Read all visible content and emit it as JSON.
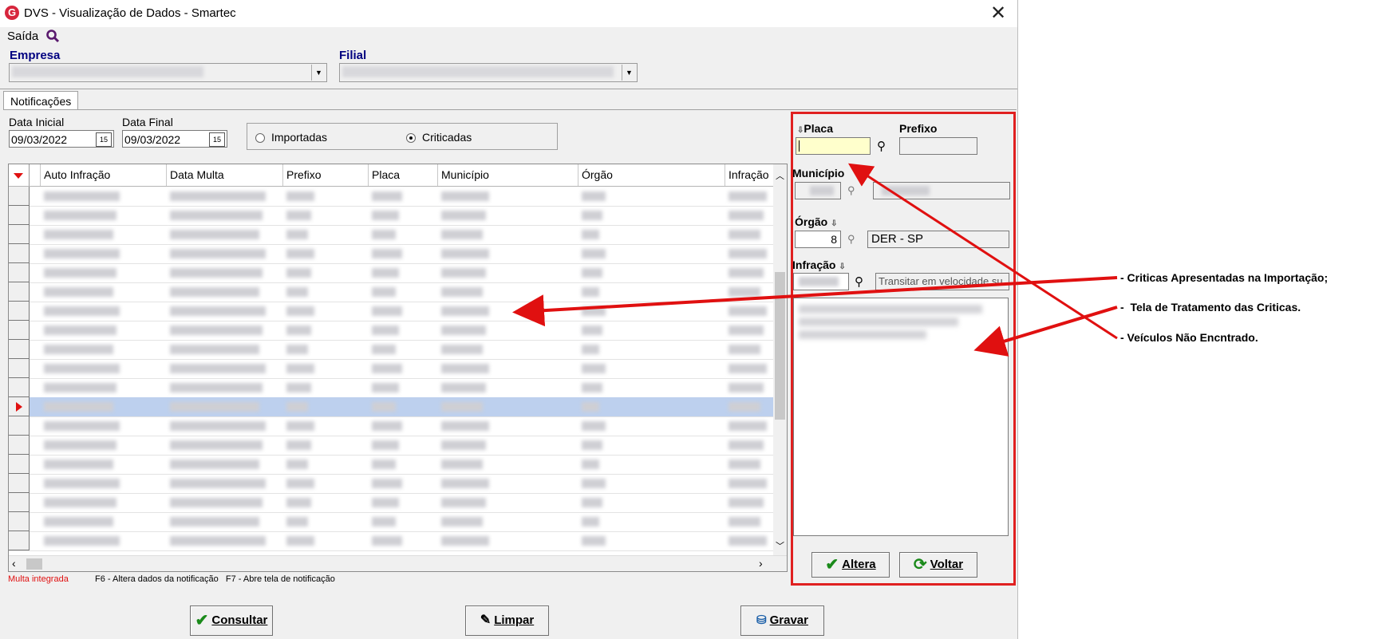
{
  "window": {
    "title": "DVS - Visualização de Dados - Smartec",
    "menu": [
      "Saída"
    ]
  },
  "filters": {
    "empresa_label": "Empresa",
    "filial_label": "Filial"
  },
  "tabs": [
    "Notificações"
  ],
  "dates": {
    "initial_label": "Data Inicial",
    "initial_value": "09/03/2022",
    "final_label": "Data Final",
    "final_value": "09/03/2022"
  },
  "radio": {
    "options": [
      "Importadas",
      "Criticadas"
    ],
    "selected": "Criticadas"
  },
  "grid": {
    "columns": [
      "Auto Infração",
      "Data Multa",
      "Prefixo",
      "Placa",
      "Município",
      "Órgão",
      "Infração"
    ],
    "selected_row": 11
  },
  "legend": {
    "red_text": "Multa integrada",
    "shortcuts": "F6 - Altera dados da notificação   F7 - Abre tela de notificação"
  },
  "buttons": {
    "consultar": "Consultar",
    "limpar": "Limpar",
    "gravar": "Gravar"
  },
  "panel": {
    "placa_label": "Placa",
    "prefixo_label": "Prefixo",
    "municipio_label": "Município",
    "orgao_label": "Órgão",
    "orgao_code": "8",
    "orgao_name": "DER - SP",
    "infracao_label": "Infração",
    "infracao_desc": "Transitar em velocidade su",
    "altera": "Altera",
    "voltar": "Voltar"
  },
  "annotations": [
    "- Criticas Apresentadas na Importação;",
    "-  Tela de Tratamento das Criticas.",
    "- Veículos Não Encntrado."
  ],
  "colors": {
    "accent_red": "#e02020",
    "selected_row": "#bdd0ee",
    "label_blue": "#000080"
  }
}
